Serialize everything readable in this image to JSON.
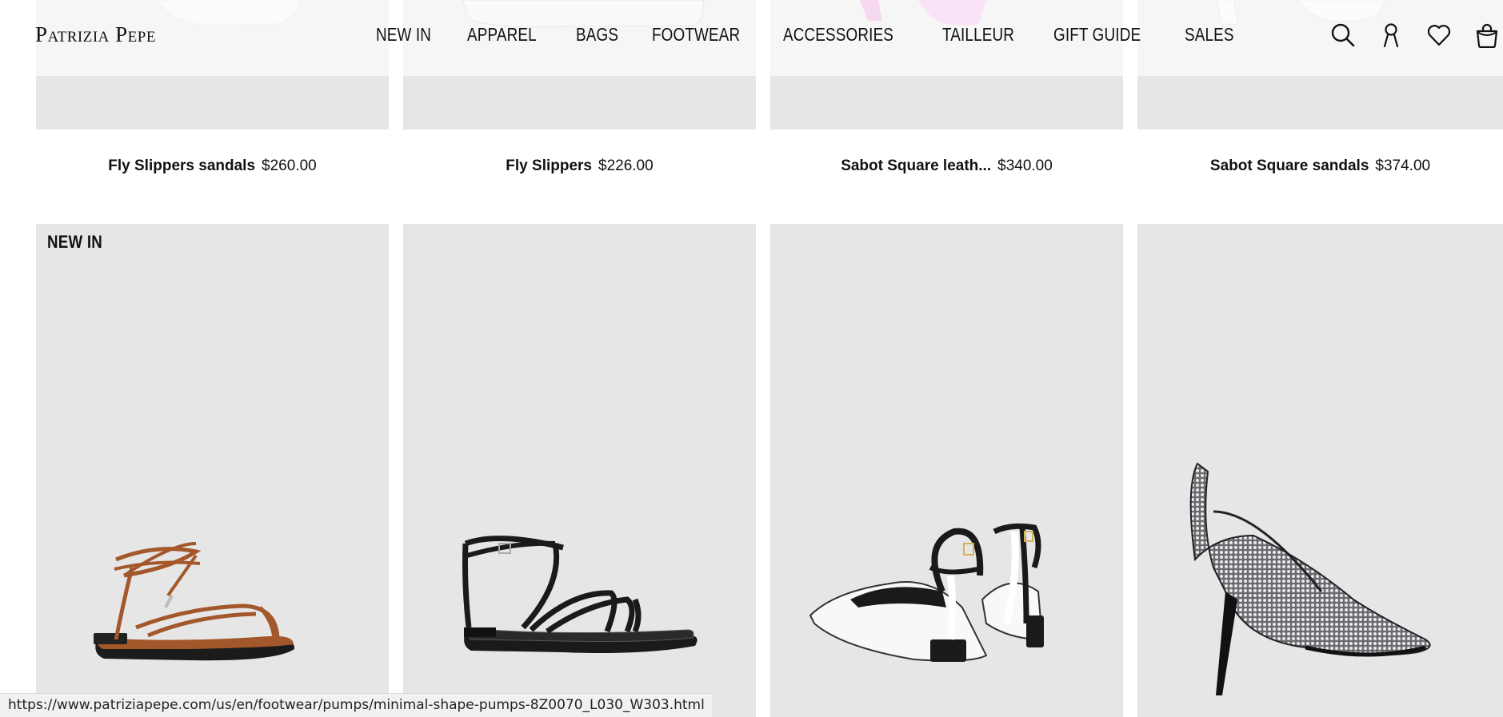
{
  "brand": {
    "logo_text": "Patrizia Pepe"
  },
  "nav": {
    "items": [
      "NEW IN",
      "APPAREL",
      "BAGS",
      "FOOTWEAR",
      "ACCESSORIES",
      "TAILLEUR",
      "GIFT GUIDE",
      "SALES"
    ]
  },
  "header_icons": [
    "search-icon",
    "account-icon",
    "wishlist-heart-icon",
    "shopping-bag-icon"
  ],
  "top_row": [
    {
      "name": "Fly Slippers sandals",
      "price": "$260.00"
    },
    {
      "name": "Fly Slippers",
      "price": "$226.00"
    },
    {
      "name": "Sabot Square leath...",
      "price": "$340.00"
    },
    {
      "name": "Sabot Square sandals",
      "price": "$374.00"
    }
  ],
  "bottom_row": [
    {
      "badge": "NEW IN",
      "image": "brown-lace-up-flat-sandal"
    },
    {
      "badge": "",
      "image": "black-strappy-flat-sandal"
    },
    {
      "badge": "",
      "image": "black-white-slingback-flats-pair"
    },
    {
      "badge": "",
      "image": "crystal-embellished-pump"
    }
  ],
  "status_bar": {
    "url": "https://www.patriziapepe.com/us/en/footwear/pumps/minimal-shape-pumps-8Z0070_L030_W303.html"
  },
  "colors": {
    "tile_bg": "#e6e6e6",
    "text": "#111111",
    "brown_leather": "#a3582b"
  }
}
